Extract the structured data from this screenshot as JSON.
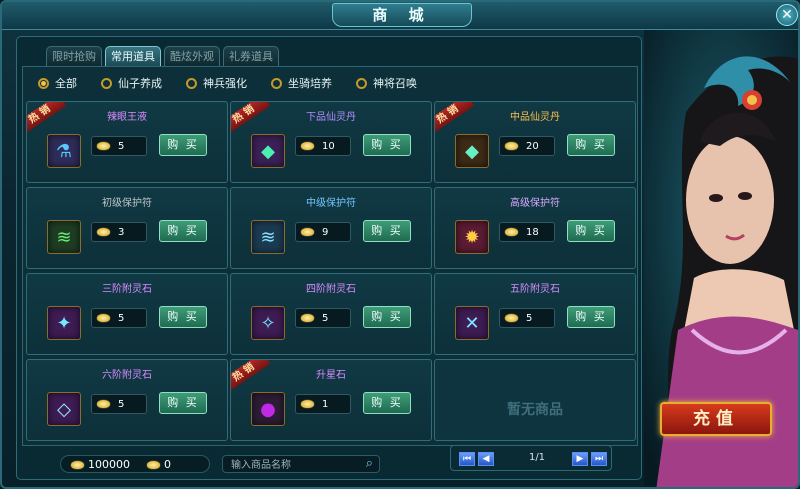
{
  "window": {
    "title": "商 城"
  },
  "tabs": [
    {
      "label": "限时抢购",
      "active": false
    },
    {
      "label": "常用道具",
      "active": true
    },
    {
      "label": "酷炫外观",
      "active": false
    },
    {
      "label": "礼券道具",
      "active": false
    }
  ],
  "filters": [
    {
      "label": "全部",
      "checked": true
    },
    {
      "label": "仙子养成",
      "checked": false
    },
    {
      "label": "神兵强化",
      "checked": false
    },
    {
      "label": "坐骑培养",
      "checked": false
    },
    {
      "label": "神将召唤",
      "checked": false
    }
  ],
  "hot_label": "热 销",
  "buy_label": "购 买",
  "items": [
    {
      "name": "辣眼王液",
      "name_color": "#d98bff",
      "price": "5",
      "hot": true,
      "icon": "potion-bag-icon",
      "icon_glyph": "⚗",
      "icon_color": "#56c7ff"
    },
    {
      "name": "下品仙灵丹",
      "name_color": "#b68bff",
      "price": "10",
      "hot": true,
      "icon": "jade-cube-icon",
      "icon_glyph": "◆",
      "icon_color": "#49f0ae"
    },
    {
      "name": "中品仙灵丹",
      "name_color": "#ffbf4d",
      "price": "20",
      "hot": true,
      "icon": "jade-cube-icon",
      "icon_glyph": "◆",
      "icon_color": "#66f0c4"
    },
    {
      "name": "初级保护符",
      "name_color": "#bfc6c9",
      "price": "3",
      "hot": false,
      "icon": "green-talisman-icon",
      "icon_glyph": "≋",
      "icon_color": "#67f06f"
    },
    {
      "name": "中级保护符",
      "name_color": "#73c7ff",
      "price": "9",
      "hot": false,
      "icon": "blue-talisman-icon",
      "icon_glyph": "≋",
      "icon_color": "#8be0ff"
    },
    {
      "name": "高级保护符",
      "name_color": "#d9a9ff",
      "price": "18",
      "hot": false,
      "icon": "red-talisman-icon",
      "icon_glyph": "✹",
      "icon_color": "#ffce45"
    },
    {
      "name": "三阶附灵石",
      "name_color": "#d98bff",
      "price": "5",
      "hot": false,
      "icon": "crystal-icon",
      "icon_glyph": "✦",
      "icon_color": "#73e8ff"
    },
    {
      "name": "四阶附灵石",
      "name_color": "#d98bff",
      "price": "5",
      "hot": false,
      "icon": "crystal-icon",
      "icon_glyph": "✧",
      "icon_color": "#73e8ff"
    },
    {
      "name": "五阶附灵石",
      "name_color": "#d98bff",
      "price": "5",
      "hot": false,
      "icon": "crystal-icon",
      "icon_glyph": "✕",
      "icon_color": "#7fe7ff"
    },
    {
      "name": "六阶附灵石",
      "name_color": "#d98bff",
      "price": "5",
      "hot": false,
      "icon": "crystal-icon",
      "icon_glyph": "◇",
      "icon_color": "#9befff"
    },
    {
      "name": "升星石",
      "name_color": "#d98bff",
      "price": "1",
      "hot": true,
      "icon": "star-stone-icon",
      "icon_glyph": "●",
      "icon_color": "#c02ae6"
    }
  ],
  "empty_label": "暂无商品",
  "currency": {
    "gold": "100000",
    "bound": "0"
  },
  "search": {
    "placeholder": "输入商品名称"
  },
  "pager": {
    "page": "1/1"
  },
  "recharge_label": "充值"
}
